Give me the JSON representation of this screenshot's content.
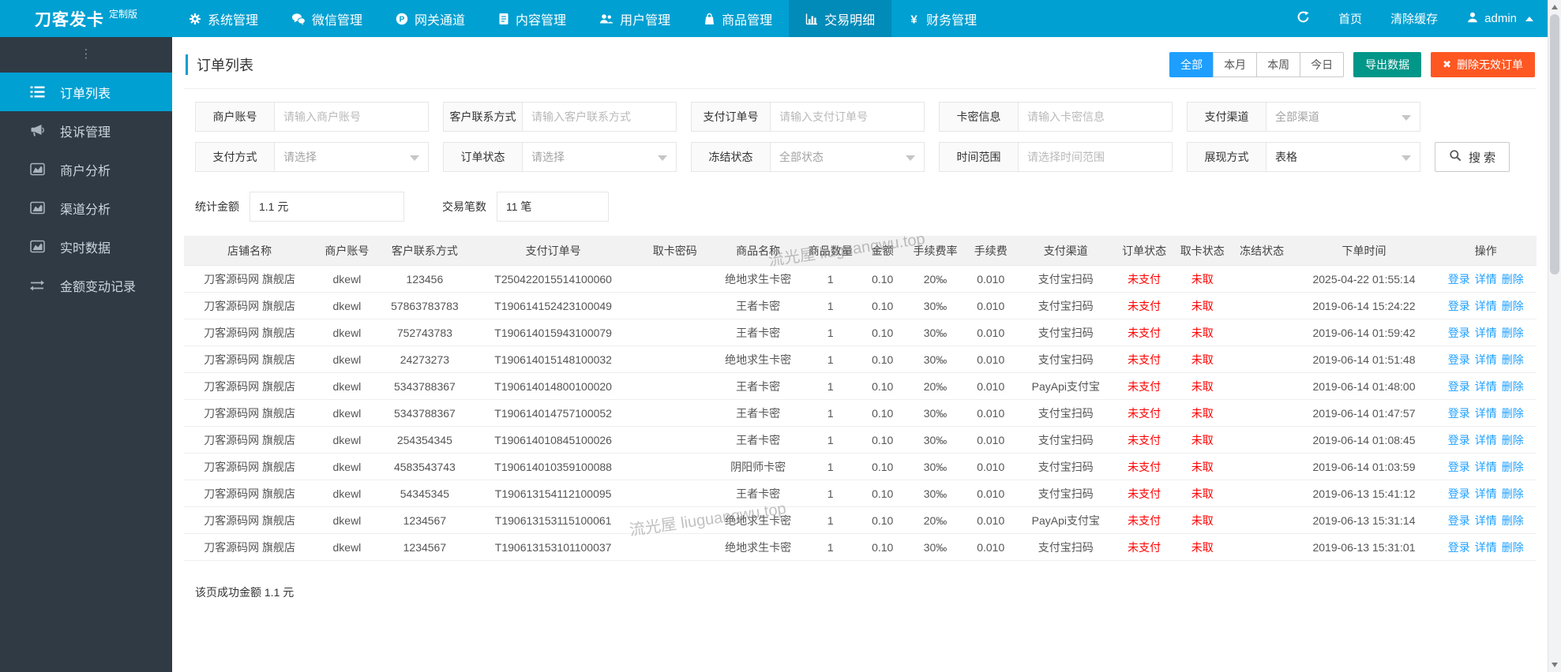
{
  "topbar": {
    "logo": "刀客发卡",
    "logo_badge": "定制版",
    "menu": [
      {
        "key": "system",
        "icon": "gear-icon",
        "label": "系统管理",
        "active": false
      },
      {
        "key": "wechat",
        "icon": "wechat-icon",
        "label": "微信管理",
        "active": false
      },
      {
        "key": "gateway",
        "icon": "gateway-p-icon",
        "label": "网关通道",
        "active": false
      },
      {
        "key": "content",
        "icon": "document-icon",
        "label": "内容管理",
        "active": false
      },
      {
        "key": "users",
        "icon": "users-icon",
        "label": "用户管理",
        "active": false
      },
      {
        "key": "goods",
        "icon": "shopping-bag-icon",
        "label": "商品管理",
        "active": false
      },
      {
        "key": "trade",
        "icon": "bar-chart-icon",
        "label": "交易明细",
        "active": true
      },
      {
        "key": "finance",
        "icon": "yen-icon",
        "label": "财务管理",
        "active": false
      }
    ],
    "right": {
      "home": "首页",
      "clear_cache": "清除缓存",
      "user": "admin"
    }
  },
  "sidebar": {
    "collapse_glyph": "⋮",
    "items": [
      {
        "key": "order-list",
        "icon": "ordered-list-icon",
        "label": "订单列表",
        "active": true
      },
      {
        "key": "complaints",
        "icon": "megaphone-icon",
        "label": "投诉管理",
        "active": false
      },
      {
        "key": "merchant-analysis",
        "icon": "area-chart-icon",
        "label": "商户分析",
        "active": false
      },
      {
        "key": "channel-analysis",
        "icon": "area-chart-icon",
        "label": "渠道分析",
        "active": false
      },
      {
        "key": "realtime-data",
        "icon": "area-chart-icon",
        "label": "实时数据",
        "active": false
      },
      {
        "key": "amount-records",
        "icon": "transfer-arrows-icon",
        "label": "金额变动记录",
        "active": false
      }
    ]
  },
  "page": {
    "title": "订单列表",
    "range_tabs": [
      {
        "key": "all",
        "label": "全部",
        "active": true
      },
      {
        "key": "month",
        "label": "本月",
        "active": false
      },
      {
        "key": "week",
        "label": "本周",
        "active": false
      },
      {
        "key": "today",
        "label": "今日",
        "active": false
      }
    ],
    "export_button": "导出数据",
    "delete_button": "删除无效订单",
    "delete_icon": "✖"
  },
  "filters": {
    "row1": [
      {
        "key": "merchant-account",
        "label": "商户账号",
        "type": "input",
        "placeholder": "请输入商户账号"
      },
      {
        "key": "customer-contact",
        "label": "客户联系方式",
        "type": "input",
        "placeholder": "请输入客户联系方式"
      },
      {
        "key": "payment-order-no",
        "label": "支付订单号",
        "type": "input",
        "placeholder": "请输入支付订单号"
      },
      {
        "key": "card-info",
        "label": "卡密信息",
        "type": "input",
        "placeholder": "请输入卡密信息"
      },
      {
        "key": "payment-channel",
        "label": "支付渠道",
        "type": "select",
        "value": "全部渠道",
        "muted": true
      }
    ],
    "row2": [
      {
        "key": "payment-method",
        "label": "支付方式",
        "type": "select",
        "value": "请选择",
        "muted": true
      },
      {
        "key": "order-status",
        "label": "订单状态",
        "type": "select",
        "value": "请选择",
        "muted": true
      },
      {
        "key": "freeze-status",
        "label": "冻结状态",
        "type": "select",
        "value": "全部状态",
        "muted": true
      },
      {
        "key": "time-range",
        "label": "时间范围",
        "type": "input",
        "placeholder": "请选择时间范围"
      },
      {
        "key": "display-mode",
        "label": "展现方式",
        "type": "select",
        "value": "表格",
        "muted": false
      }
    ],
    "search_button": "搜 索"
  },
  "stats": {
    "amount_label": "统计金额",
    "amount_value": "1.1 元",
    "count_label": "交易笔数",
    "count_value": "11 笔"
  },
  "table": {
    "headers": [
      "店铺名称",
      "商户账号",
      "客户联系方式",
      "支付订单号",
      "取卡密码",
      "商品名称",
      "商品数量",
      "金额",
      "手续费率",
      "手续费",
      "支付渠道",
      "订单状态",
      "取卡状态",
      "冻结状态",
      "下单时间",
      "操作"
    ],
    "actions": [
      "登录",
      "详情",
      "删除"
    ],
    "rows": [
      {
        "shop": "刀客源码网 旗舰店",
        "merchant": "dkewl",
        "contact": "123456",
        "order_no": "T250422015514100060",
        "card_pwd": "",
        "product": "绝地求生卡密",
        "qty": "1",
        "amount": "0.10",
        "fee_rate": "20‰",
        "fee": "0.010",
        "channel": "支付宝扫码",
        "order_status": "未支付",
        "card_status": "未取",
        "freeze_status": "",
        "time": "2025-04-22 01:55:14"
      },
      {
        "shop": "刀客源码网 旗舰店",
        "merchant": "dkewl",
        "contact": "57863783783",
        "order_no": "T190614152423100049",
        "card_pwd": "",
        "product": "王者卡密",
        "qty": "1",
        "amount": "0.10",
        "fee_rate": "30‰",
        "fee": "0.010",
        "channel": "支付宝扫码",
        "order_status": "未支付",
        "card_status": "未取",
        "freeze_status": "",
        "time": "2019-06-14 15:24:22"
      },
      {
        "shop": "刀客源码网 旗舰店",
        "merchant": "dkewl",
        "contact": "752743783",
        "order_no": "T190614015943100079",
        "card_pwd": "",
        "product": "王者卡密",
        "qty": "1",
        "amount": "0.10",
        "fee_rate": "30‰",
        "fee": "0.010",
        "channel": "支付宝扫码",
        "order_status": "未支付",
        "card_status": "未取",
        "freeze_status": "",
        "time": "2019-06-14 01:59:42"
      },
      {
        "shop": "刀客源码网 旗舰店",
        "merchant": "dkewl",
        "contact": "24273273",
        "order_no": "T190614015148100032",
        "card_pwd": "",
        "product": "绝地求生卡密",
        "qty": "1",
        "amount": "0.10",
        "fee_rate": "30‰",
        "fee": "0.010",
        "channel": "支付宝扫码",
        "order_status": "未支付",
        "card_status": "未取",
        "freeze_status": "",
        "time": "2019-06-14 01:51:48"
      },
      {
        "shop": "刀客源码网 旗舰店",
        "merchant": "dkewl",
        "contact": "5343788367",
        "order_no": "T190614014800100020",
        "card_pwd": "",
        "product": "王者卡密",
        "qty": "1",
        "amount": "0.10",
        "fee_rate": "20‰",
        "fee": "0.010",
        "channel": "PayApi支付宝",
        "order_status": "未支付",
        "card_status": "未取",
        "freeze_status": "",
        "time": "2019-06-14 01:48:00"
      },
      {
        "shop": "刀客源码网 旗舰店",
        "merchant": "dkewl",
        "contact": "5343788367",
        "order_no": "T190614014757100052",
        "card_pwd": "",
        "product": "王者卡密",
        "qty": "1",
        "amount": "0.10",
        "fee_rate": "30‰",
        "fee": "0.010",
        "channel": "支付宝扫码",
        "order_status": "未支付",
        "card_status": "未取",
        "freeze_status": "",
        "time": "2019-06-14 01:47:57"
      },
      {
        "shop": "刀客源码网 旗舰店",
        "merchant": "dkewl",
        "contact": "254354345",
        "order_no": "T190614010845100026",
        "card_pwd": "",
        "product": "王者卡密",
        "qty": "1",
        "amount": "0.10",
        "fee_rate": "30‰",
        "fee": "0.010",
        "channel": "支付宝扫码",
        "order_status": "未支付",
        "card_status": "未取",
        "freeze_status": "",
        "time": "2019-06-14 01:08:45"
      },
      {
        "shop": "刀客源码网 旗舰店",
        "merchant": "dkewl",
        "contact": "4583543743",
        "order_no": "T190614010359100088",
        "card_pwd": "",
        "product": "阴阳师卡密",
        "qty": "1",
        "amount": "0.10",
        "fee_rate": "30‰",
        "fee": "0.010",
        "channel": "支付宝扫码",
        "order_status": "未支付",
        "card_status": "未取",
        "freeze_status": "",
        "time": "2019-06-14 01:03:59"
      },
      {
        "shop": "刀客源码网 旗舰店",
        "merchant": "dkewl",
        "contact": "54345345",
        "order_no": "T190613154112100095",
        "card_pwd": "",
        "product": "王者卡密",
        "qty": "1",
        "amount": "0.10",
        "fee_rate": "30‰",
        "fee": "0.010",
        "channel": "支付宝扫码",
        "order_status": "未支付",
        "card_status": "未取",
        "freeze_status": "",
        "time": "2019-06-13 15:41:12"
      },
      {
        "shop": "刀客源码网 旗舰店",
        "merchant": "dkewl",
        "contact": "1234567",
        "order_no": "T190613153115100061",
        "card_pwd": "",
        "product": "绝地求生卡密",
        "qty": "1",
        "amount": "0.10",
        "fee_rate": "20‰",
        "fee": "0.010",
        "channel": "PayApi支付宝",
        "order_status": "未支付",
        "card_status": "未取",
        "freeze_status": "",
        "time": "2019-06-13 15:31:14"
      },
      {
        "shop": "刀客源码网 旗舰店",
        "merchant": "dkewl",
        "contact": "1234567",
        "order_no": "T190613153101100037",
        "card_pwd": "",
        "product": "绝地求生卡密",
        "qty": "1",
        "amount": "0.10",
        "fee_rate": "30‰",
        "fee": "0.010",
        "channel": "支付宝扫码",
        "order_status": "未支付",
        "card_status": "未取",
        "freeze_status": "",
        "time": "2019-06-13 15:31:01"
      }
    ]
  },
  "footer": {
    "summary": "该页成功金额 1.1 元"
  },
  "watermark": {
    "text": "流光屋 liuguangwu.top"
  },
  "colors": {
    "topbar": "#00a0d2",
    "topbar_active": "#018bb8",
    "sidebar": "#2f3a45",
    "tab_active": "#1e9fff",
    "export": "#009688",
    "delete": "#ff5722",
    "status_red": "#ff0000",
    "link_blue": "#1e9fff"
  }
}
